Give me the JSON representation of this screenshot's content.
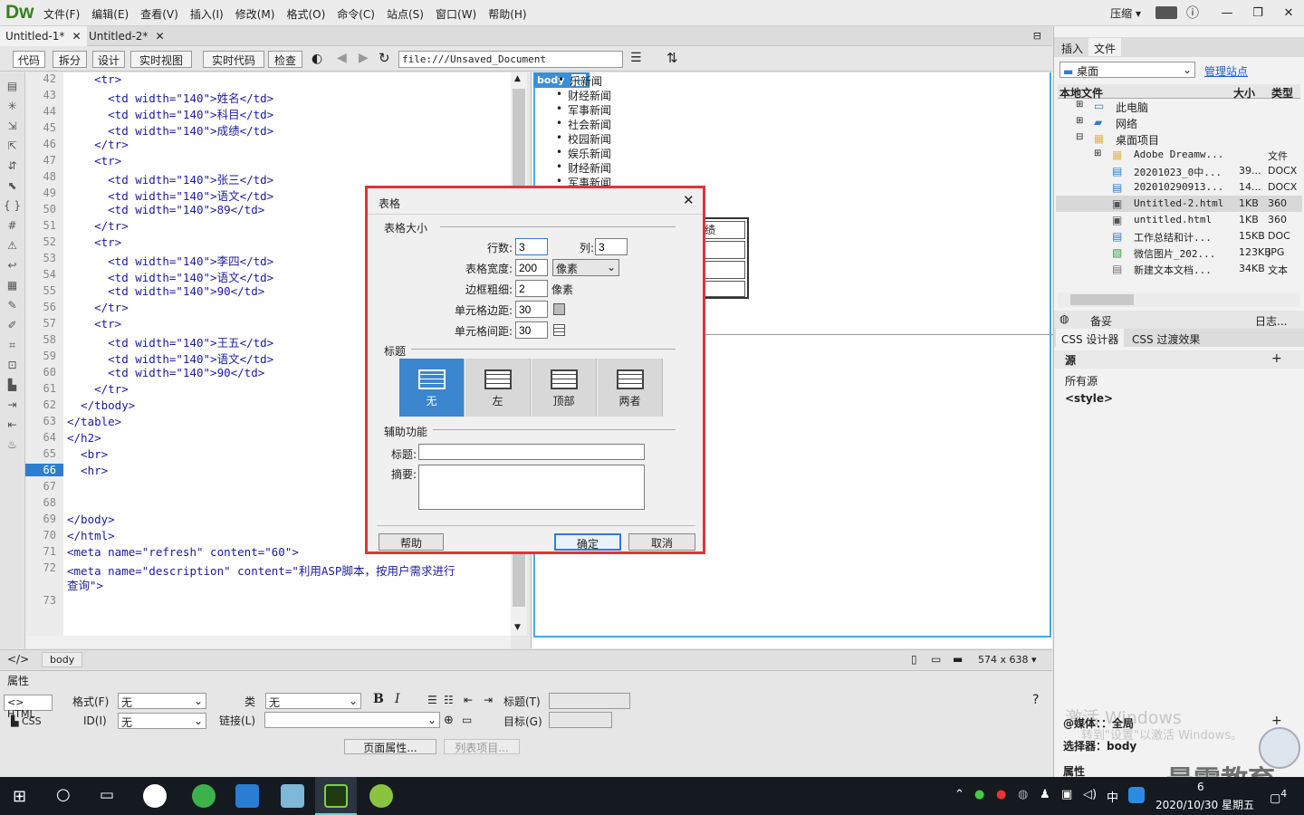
{
  "app": {
    "logo": "Dw"
  },
  "menu": [
    "文件(F)",
    "编辑(E)",
    "查看(V)",
    "插入(I)",
    "修改(M)",
    "格式(O)",
    "命令(C)",
    "站点(S)",
    "窗口(W)",
    "帮助(H)"
  ],
  "layout_mode": "压缩",
  "doc_tabs": [
    "Untitled-1*",
    "Untitled-2*"
  ],
  "toolbar": {
    "code": "代码",
    "split": "拆分",
    "design": "设计",
    "live_view": "实时视图",
    "live_code": "实时代码",
    "inspect": "检查",
    "address": "file:///Unsaved_Document"
  },
  "code_lines": [
    {
      "n": "42",
      "text": "    <tr>"
    },
    {
      "n": "43",
      "text": "      <td width=\"140\">姓名</td>"
    },
    {
      "n": "44",
      "text": "      <td width=\"140\">科目</td>"
    },
    {
      "n": "45",
      "text": "      <td width=\"140\">成绩</td>"
    },
    {
      "n": "46",
      "text": "    </tr>"
    },
    {
      "n": "47",
      "text": "    <tr>"
    },
    {
      "n": "48",
      "text": "      <td width=\"140\">张三</td>"
    },
    {
      "n": "49",
      "text": "      <td width=\"140\">语文</td>"
    },
    {
      "n": "50",
      "text": "      <td width=\"140\">89</td>"
    },
    {
      "n": "51",
      "text": "    </tr>"
    },
    {
      "n": "52",
      "text": "    <tr>"
    },
    {
      "n": "53",
      "text": "      <td width=\"140\">李四</td>"
    },
    {
      "n": "54",
      "text": "      <td width=\"140\">语文</td>"
    },
    {
      "n": "55",
      "text": "      <td width=\"140\">90</td>"
    },
    {
      "n": "56",
      "text": "    </tr>"
    },
    {
      "n": "57",
      "text": "    <tr>"
    },
    {
      "n": "58",
      "text": "      <td width=\"140\">王五</td>"
    },
    {
      "n": "59",
      "text": "      <td width=\"140\">语文</td>"
    },
    {
      "n": "60",
      "text": "      <td width=\"140\">90</td>"
    },
    {
      "n": "61",
      "text": "    </tr>"
    },
    {
      "n": "62",
      "text": "  </tbody>"
    },
    {
      "n": "63",
      "text": "</table>"
    },
    {
      "n": "64",
      "text": "</h2>"
    },
    {
      "n": "65",
      "text": "  <br>"
    },
    {
      "n": "66",
      "text": "  <hr>"
    },
    {
      "n": "67",
      "text": ""
    },
    {
      "n": "68",
      "text": ""
    },
    {
      "n": "69",
      "text": "</body>"
    },
    {
      "n": "70",
      "text": "</html>"
    },
    {
      "n": "71",
      "text": "<meta name=\"refresh\" content=\"60\">"
    },
    {
      "n": "72",
      "text": "<meta name=\"description\" content=\"利用ASP脚本，按用户需求进行"
    },
    {
      "n": "",
      "text": "查询\">"
    },
    {
      "n": "73",
      "text": ""
    }
  ],
  "design_view": {
    "body_tag": "body",
    "news": [
      "乐新闻",
      "财经新闻",
      "军事新闻",
      "社会新闻",
      "校园新闻",
      "娱乐新闻",
      "财经新闻",
      "军事新闻"
    ],
    "table_cell": "绩"
  },
  "status": {
    "tag": "body",
    "size": "574 x 638"
  },
  "properties": {
    "title": "属性",
    "html": "HTML",
    "css": "CSS",
    "format_label": "格式(F)",
    "format_value": "无",
    "id_label": "ID(I)",
    "id_value": "无",
    "class_label": "类",
    "class_value": "无",
    "link_label": "链接(L)",
    "title_label": "标题(T)",
    "target_label": "目标(G)",
    "page_props": "页面属性...",
    "list_item": "列表项目..."
  },
  "right_panel": {
    "tabs": [
      "插入",
      "文件"
    ],
    "location": "桌面",
    "manage": "管理站点",
    "cols": [
      "本地文件",
      "大小",
      "类型"
    ],
    "tree": [
      {
        "name": "此电脑",
        "size": "",
        "type": ""
      },
      {
        "name": "网络",
        "size": "",
        "type": ""
      },
      {
        "name": "桌面项目",
        "size": "",
        "type": ""
      },
      {
        "name": "Adobe Dreamw...",
        "size": "",
        "type": "文件"
      },
      {
        "name": "20201023_0中...",
        "size": "39...",
        "type": "DOCX"
      },
      {
        "name": "202010290913...",
        "size": "14...",
        "type": "DOCX"
      },
      {
        "name": "Untitled-2.html",
        "size": "1KB",
        "type": "360"
      },
      {
        "name": "untitled.html",
        "size": "1KB",
        "type": "360"
      },
      {
        "name": "工作总结和计...",
        "size": "15KB",
        "type": "DOC"
      },
      {
        "name": "微信图片_202...",
        "size": "123KB",
        "type": "JPG"
      },
      {
        "name": "新建文本文档...",
        "size": "34KB",
        "type": "文本"
      }
    ],
    "backup": "备妥",
    "log": "日志...",
    "css_tabs": [
      "CSS 设计器",
      "CSS 过渡效果"
    ],
    "sources": "源",
    "all_sources": "所有源",
    "style": "<style>",
    "media": "@媒体：：全局",
    "selector": "选择器：body",
    "prop": "属性",
    "watermark1": "激活 Windows",
    "watermark2": "转到\"设置\"以激活 Windows。",
    "brand": "最需教育"
  },
  "dialog": {
    "title": "表格",
    "size_section": "表格大小",
    "rows_label": "行数:",
    "rows": "3",
    "cols_label": "列:",
    "cols": "3",
    "width_label": "表格宽度:",
    "width": "200",
    "width_unit": "像素",
    "border_label": "边框粗细:",
    "border": "2",
    "border_unit": "像素",
    "padding_label": "单元格边距:",
    "padding": "30",
    "spacing_label": "单元格间距:",
    "spacing": "30",
    "header_section": "标题",
    "headers": [
      "无",
      "左",
      "顶部",
      "两者"
    ],
    "access_section": "辅助功能",
    "caption_label": "标题:",
    "summary_label": "摘要:",
    "help": "帮助",
    "ok": "确定",
    "cancel": "取消"
  },
  "taskbar": {
    "time": "6",
    "date": "2020/10/30 星期五",
    "ime": "中",
    "badge": "4"
  }
}
